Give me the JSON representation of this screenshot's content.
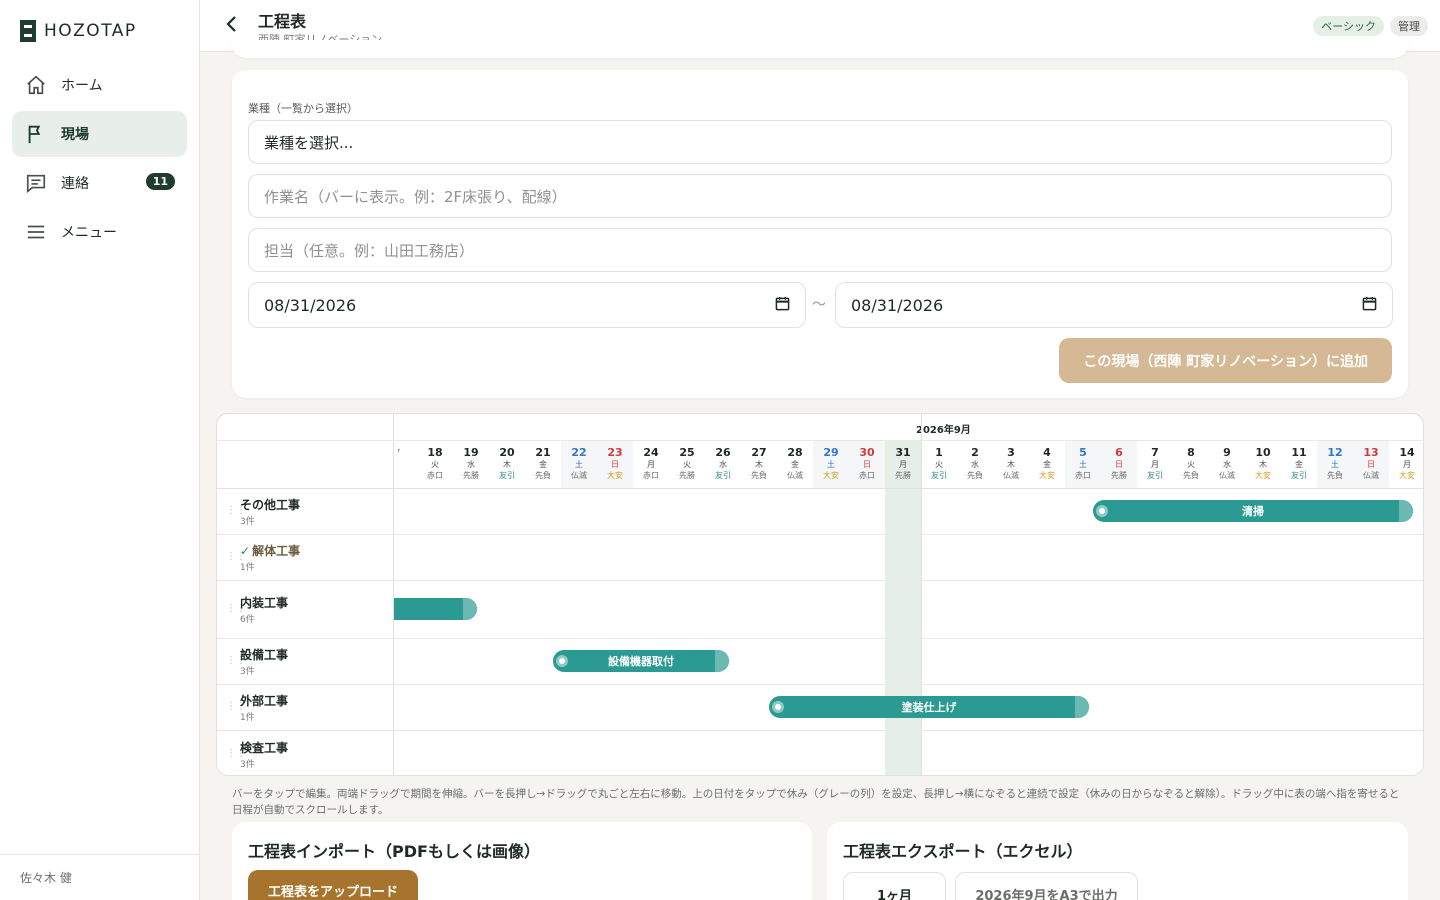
{
  "app": {
    "logo_text": "HOZOTAP"
  },
  "nav": {
    "items": [
      {
        "label": "ホーム",
        "icon": "home-icon"
      },
      {
        "label": "現場",
        "icon": "flag-icon",
        "active": true
      },
      {
        "label": "連絡",
        "icon": "message-icon",
        "badge": "11"
      },
      {
        "label": "メニュー",
        "icon": "menu-icon"
      }
    ]
  },
  "user": {
    "name": "佐々木 健"
  },
  "header": {
    "title": "工程表",
    "subtitle": "西陣 町家リノベーション",
    "plan_badge": "ベーシック",
    "role_badge": "管理"
  },
  "form": {
    "trade_label": "業種（一覧から選択）",
    "trade_value": "業種を選択...",
    "task_placeholder": "作業名（バーに表示。例：2F床張り、配線）",
    "assignee_placeholder": "担当（任意。例：山田工務店）",
    "start_date": "08/31/2026",
    "end_date": "08/31/2026",
    "tilde": "〜",
    "add_button": "この現場（西陣 町家リノベーション）に追加"
  },
  "gantt": {
    "month_label": "2026年9月",
    "days": [
      {
        "n": "",
        "w": "",
        "r": "⸢"
      },
      {
        "n": "18",
        "w": "火",
        "r": "赤口"
      },
      {
        "n": "19",
        "w": "水",
        "r": "先勝"
      },
      {
        "n": "20",
        "w": "木",
        "r": "友引"
      },
      {
        "n": "21",
        "w": "金",
        "r": "先負"
      },
      {
        "n": "22",
        "w": "土",
        "r": "仏滅"
      },
      {
        "n": "23",
        "w": "日",
        "r": "大安"
      },
      {
        "n": "24",
        "w": "月",
        "r": "赤口"
      },
      {
        "n": "25",
        "w": "火",
        "r": "先勝"
      },
      {
        "n": "26",
        "w": "水",
        "r": "友引"
      },
      {
        "n": "27",
        "w": "木",
        "r": "先負"
      },
      {
        "n": "28",
        "w": "金",
        "r": "仏滅"
      },
      {
        "n": "29",
        "w": "土",
        "r": "大安"
      },
      {
        "n": "30",
        "w": "日",
        "r": "赤口"
      },
      {
        "n": "31",
        "w": "月",
        "r": "先勝"
      },
      {
        "n": "1",
        "w": "火",
        "r": "友引"
      },
      {
        "n": "2",
        "w": "水",
        "r": "先負"
      },
      {
        "n": "3",
        "w": "木",
        "r": "仏滅"
      },
      {
        "n": "4",
        "w": "金",
        "r": "大安"
      },
      {
        "n": "5",
        "w": "土",
        "r": "赤口"
      },
      {
        "n": "6",
        "w": "日",
        "r": "先勝"
      },
      {
        "n": "7",
        "w": "月",
        "r": "友引"
      },
      {
        "n": "8",
        "w": "火",
        "r": "先負"
      },
      {
        "n": "9",
        "w": "水",
        "r": "仏滅"
      },
      {
        "n": "10",
        "w": "木",
        "r": "大安"
      },
      {
        "n": "11",
        "w": "金",
        "r": "友引"
      },
      {
        "n": "12",
        "w": "土",
        "r": "先負"
      },
      {
        "n": "13",
        "w": "日",
        "r": "仏滅"
      },
      {
        "n": "14",
        "w": "月",
        "r": "大安"
      }
    ],
    "categories": [
      {
        "name": "その他工事",
        "count": "3件"
      },
      {
        "name": "解体工事",
        "count": "1件",
        "done": true
      },
      {
        "name": "内装工事",
        "count": "6件"
      },
      {
        "name": "設備工事",
        "count": "3件"
      },
      {
        "name": "外部工事",
        "count": "1件"
      },
      {
        "name": "検査工事",
        "count": "3件"
      }
    ],
    "bars": [
      {
        "label": "清掃",
        "row": 0
      },
      {
        "label": "",
        "row": 2
      },
      {
        "label": "設備機器取付",
        "row": 3
      },
      {
        "label": "塗装仕上げ",
        "row": 4
      }
    ]
  },
  "hint": "バーをタップで編集。両端ドラッグで期間を伸縮。バーを長押し→ドラッグで丸ごと左右に移動。上の日付をタップで休み（グレーの列）を設定、長押し→横になぞると連続で設定（休みの日からなぞると解除）。ドラッグ中に表の端へ指を寄せると日程が自動でスクロールします。",
  "import_card": {
    "title": "工程表インポート（PDFもしくは画像）",
    "upload_button": "工程表をアップロード"
  },
  "export_card": {
    "title": "工程表エクスポート（エクセル）",
    "range_option": "1ヶ月",
    "export_button": "2026年9月をA3で出力"
  },
  "colors": {
    "accent": "#1f3d2e",
    "bar": "#2a9a93",
    "add_button": "#d4b994",
    "upload_button": "#a6742d",
    "today": "#e6efe7",
    "saturday": "#2f77c9",
    "sunday": "#d23b3b"
  }
}
